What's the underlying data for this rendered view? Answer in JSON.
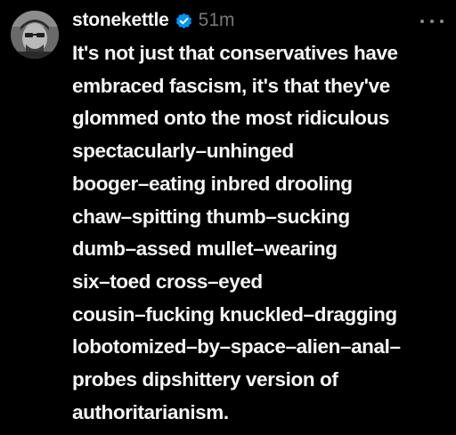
{
  "post": {
    "username": "stonekettle",
    "timestamp": "51m",
    "verified_icon": "verified-badge-icon",
    "avatar_icon": "profile-photo",
    "more_icon": "more-options-icon",
    "accent_color": "#0095f6",
    "lines": [
      "It's not just that conservatives have",
      "embraced fascism, it's that they've",
      "glommed onto the most ridiculous",
      "spectacularly–unhinged",
      "booger–eating inbred drooling",
      "chaw–spitting thumb–sucking",
      "dumb–assed mullet–wearing",
      "six–toed cross–eyed",
      "cousin–fucking knuckled–dragging",
      "lobotomized–by–space–alien–anal–",
      "probes dipshittery version of",
      "authoritarianism."
    ]
  }
}
